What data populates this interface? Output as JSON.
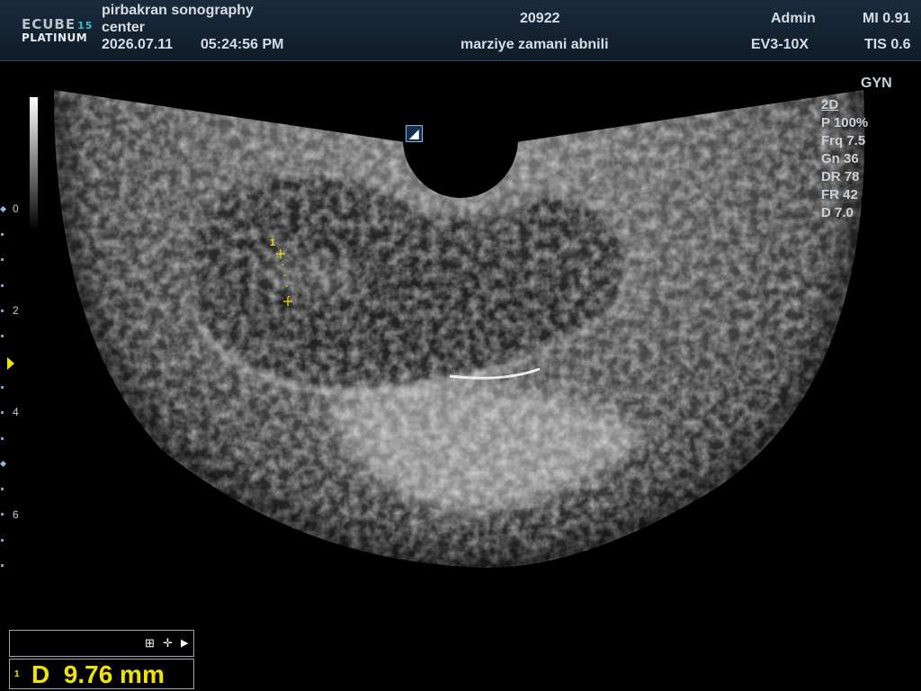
{
  "header": {
    "logo_line1": "ECUBE",
    "logo_model_num": "15",
    "logo_line2": "PLATINUM",
    "clinic_name_line1": "pirbakran sonography",
    "clinic_name_line2": "center",
    "date": "2026.07.11",
    "time": "05:24:56  PM",
    "patient_id": "20922",
    "patient_name": "marziye zamani abnili",
    "operator": "Admin",
    "probe": "EV3-10X",
    "mi": "MI 0.91",
    "tis": "TIS 0.6"
  },
  "depth_scale": {
    "labels": [
      "0",
      "2",
      "4",
      "6"
    ]
  },
  "preset": "GYN",
  "imaging_params": {
    "mode": "2D",
    "power": "P 100%",
    "frequency": "Frq 7.5",
    "gain": "Gn 36",
    "dynamic_range": "DR 78",
    "frame_rate": "FR 42",
    "depth": "D 7.0"
  },
  "orientation_marker": "◢",
  "caliper": {
    "label": "1"
  },
  "measurement": {
    "index": "1",
    "label": "D  9.76 mm",
    "value_mm": 9.76
  },
  "tools": {
    "icons": [
      "grid-icon",
      "move-icon",
      "play-icon"
    ],
    "glyphs": [
      "⊞",
      "✛",
      "▶"
    ]
  },
  "colors": {
    "accent_yellow": "#f2e400",
    "header_bg": "#13222f",
    "text": "#d6dde4",
    "logo_teal": "#35c0c8"
  }
}
